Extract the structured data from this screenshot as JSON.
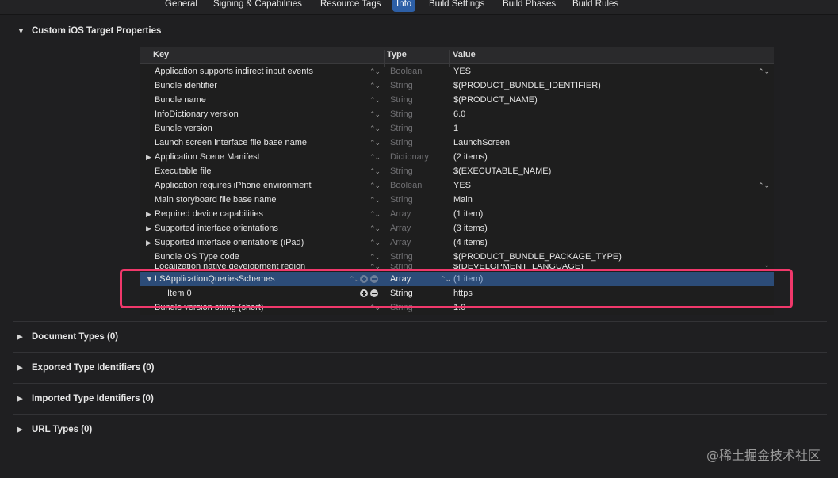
{
  "tabs": [
    {
      "label": "General"
    },
    {
      "label": "Signing & Capabilities"
    },
    {
      "label": "Resource Tags"
    },
    {
      "label": "Info"
    },
    {
      "label": "Build Settings"
    },
    {
      "label": "Build Phases"
    },
    {
      "label": "Build Rules"
    }
  ],
  "sections": {
    "custom_ios": "Custom iOS Target Properties",
    "document_types": "Document Types (0)",
    "exported_types": "Exported Type Identifiers (0)",
    "imported_types": "Imported Type Identifiers (0)",
    "url_types": "URL Types (0)"
  },
  "table": {
    "headers": {
      "key": "Key",
      "type": "Type",
      "value": "Value"
    },
    "rows": [
      {
        "key": "Application supports indirect input events",
        "type": "Boolean",
        "value": "YES"
      },
      {
        "key": "Bundle identifier",
        "type": "String",
        "value": "$(PRODUCT_BUNDLE_IDENTIFIER)"
      },
      {
        "key": "Bundle name",
        "type": "String",
        "value": "$(PRODUCT_NAME)"
      },
      {
        "key": "InfoDictionary version",
        "type": "String",
        "value": "6.0"
      },
      {
        "key": "Bundle version",
        "type": "String",
        "value": "1"
      },
      {
        "key": "Launch screen interface file base name",
        "type": "String",
        "value": "LaunchScreen"
      },
      {
        "key": "Application Scene Manifest",
        "type": "Dictionary",
        "value": "(2 items)"
      },
      {
        "key": "Executable file",
        "type": "String",
        "value": "$(EXECUTABLE_NAME)"
      },
      {
        "key": "Application requires iPhone environment",
        "type": "Boolean",
        "value": "YES"
      },
      {
        "key": "Main storyboard file base name",
        "type": "String",
        "value": "Main"
      },
      {
        "key": "Required device capabilities",
        "type": "Array",
        "value": "(1 item)"
      },
      {
        "key": "Supported interface orientations",
        "type": "Array",
        "value": "(3 items)"
      },
      {
        "key": "Supported interface orientations (iPad)",
        "type": "Array",
        "value": "(4 items)"
      },
      {
        "key": "Bundle OS Type code",
        "type": "String",
        "value": "$(PRODUCT_BUNDLE_PACKAGE_TYPE)"
      },
      {
        "key": "Localization native development region",
        "type": "String",
        "value": "$(DEVELOPMENT_LANGUAGE)"
      },
      {
        "key": "LSApplicationQueriesSchemes",
        "type": "Array",
        "value": "(1 item)"
      },
      {
        "key": "Item 0",
        "type": "String",
        "value": "https"
      },
      {
        "key": "Bundle version string (short)",
        "type": "String",
        "value": "1.0"
      }
    ]
  },
  "watermark": "@稀土掘金技术社区",
  "colors": {
    "selected_row": "#2c4c78",
    "highlight_box": "#f0386b",
    "active_tab": "#2d5fa6"
  }
}
